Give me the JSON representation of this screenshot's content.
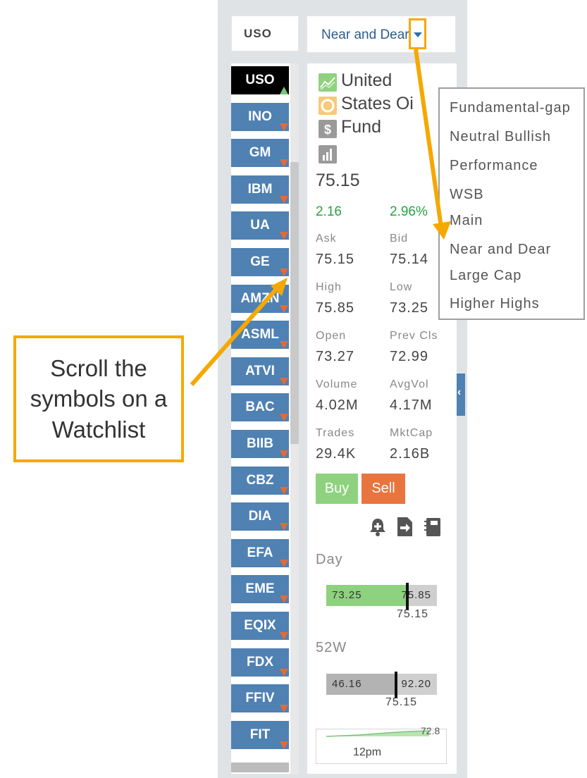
{
  "header": {
    "symbol": "USO",
    "watchlist": "Near and Dear"
  },
  "symbols": [
    {
      "ticker": "USO",
      "active": true,
      "direction": "up"
    },
    {
      "ticker": "INO",
      "active": false,
      "direction": "down"
    },
    {
      "ticker": "GM",
      "active": false,
      "direction": "down"
    },
    {
      "ticker": "IBM",
      "active": false,
      "direction": "down"
    },
    {
      "ticker": "UA",
      "active": false,
      "direction": "down"
    },
    {
      "ticker": "GE",
      "active": false,
      "direction": "down"
    },
    {
      "ticker": "AMZN",
      "active": false,
      "direction": "down"
    },
    {
      "ticker": "ASML",
      "active": false,
      "direction": "down"
    },
    {
      "ticker": "ATVI",
      "active": false,
      "direction": "down"
    },
    {
      "ticker": "BAC",
      "active": false,
      "direction": "down"
    },
    {
      "ticker": "BIIB",
      "active": false,
      "direction": "down"
    },
    {
      "ticker": "CBZ",
      "active": false,
      "direction": "down"
    },
    {
      "ticker": "DIA",
      "active": false,
      "direction": "down"
    },
    {
      "ticker": "EFA",
      "active": false,
      "direction": "down"
    },
    {
      "ticker": "EME",
      "active": false,
      "direction": "down"
    },
    {
      "ticker": "EQIX",
      "active": false,
      "direction": "down"
    },
    {
      "ticker": "FDX",
      "active": false,
      "direction": "down"
    },
    {
      "ticker": "FFIV",
      "active": false,
      "direction": "down"
    },
    {
      "ticker": "FIT",
      "active": false,
      "direction": "down"
    }
  ],
  "detail": {
    "name_lines": [
      "United",
      "States Oi",
      "Fund"
    ],
    "icons": [
      "chart-area-icon",
      "circle-icon",
      "dollar-icon",
      "bar-chart-icon"
    ],
    "price": "75.15",
    "change": "2.16",
    "change_pct": "2.96%",
    "stats": [
      {
        "label": "Ask",
        "value": "75.15"
      },
      {
        "label": "Bid",
        "value": "75.14"
      },
      {
        "label": "High",
        "value": "75.85"
      },
      {
        "label": "Low",
        "value": "73.25"
      },
      {
        "label": "Open",
        "value": "73.27"
      },
      {
        "label": "Prev Cls",
        "value": "72.99"
      },
      {
        "label": "Volume",
        "value": "4.02M"
      },
      {
        "label": "AvgVol",
        "value": "4.17M"
      },
      {
        "label": "Trades",
        "value": "29.4K"
      },
      {
        "label": "MktCap",
        "value": "2.16B"
      }
    ],
    "buy_label": "Buy",
    "sell_label": "Sell",
    "tool_icons": [
      "alert-bell-icon",
      "export-document-icon",
      "notebook-icon"
    ],
    "day": {
      "title": "Day",
      "low": "73.25",
      "high": "75.85",
      "current": "75.15",
      "position": 0.73,
      "color": "#8ed27f"
    },
    "week52": {
      "title": "52W",
      "low": "46.16",
      "high": "92.20",
      "current": "75.15",
      "position": 0.63,
      "color": "#b3b3b3"
    },
    "mini_chart": {
      "value": "72.8",
      "time": "12pm"
    }
  },
  "dropdown": {
    "items": [
      "Fundamental-gap",
      "Neutral Bullish",
      "Performance",
      "WSB",
      "Main",
      "Near and Dear",
      "Large Cap",
      "Higher Highs"
    ]
  },
  "callout": {
    "text": "Scroll the symbols on a Watchlist"
  },
  "colors": {
    "accent": "#f5a800",
    "symbol_button": "#4f81b3",
    "up": "#79c57a",
    "down": "#e06a3a"
  }
}
